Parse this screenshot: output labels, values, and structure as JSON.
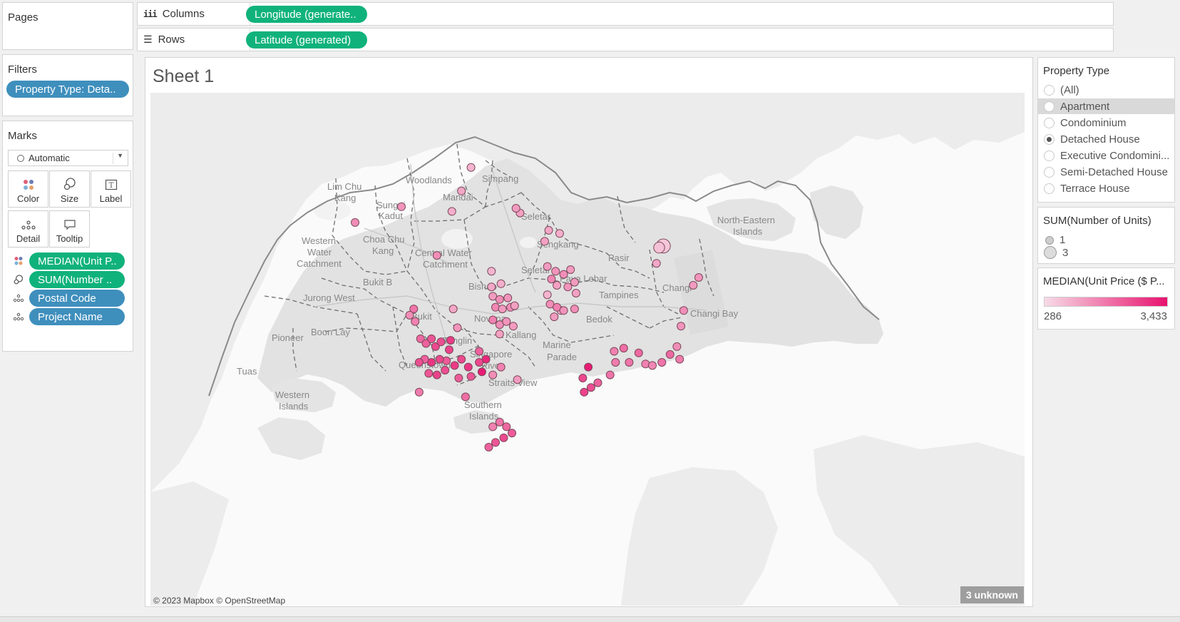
{
  "pages": {
    "title": "Pages"
  },
  "shelves": {
    "columns": {
      "label": "Columns",
      "pill": "Longitude (generate.."
    },
    "rows": {
      "label": "Rows",
      "pill": "Latitude (generated)"
    }
  },
  "filters": {
    "title": "Filters",
    "pill": "Property Type: Deta.."
  },
  "marks": {
    "title": "Marks",
    "mark_type": "Automatic",
    "buttons": {
      "color": "Color",
      "size": "Size",
      "label": "Label",
      "detail": "Detail",
      "tooltip": "Tooltip"
    },
    "fields": [
      "MEDIAN(Unit P..",
      "SUM(Number ..",
      "Postal Code",
      "Project Name"
    ],
    "field_icons": [
      "color-icon",
      "size-icon",
      "detail-icon",
      "detail-icon"
    ]
  },
  "sheet": {
    "title": "Sheet 1",
    "attribution": "© 2023 Mapbox © OpenStreetMap",
    "unknown_badge": "3 unknown"
  },
  "map_labels": [
    {
      "text": "Woodlands"
    },
    {
      "text": "Simpang"
    },
    {
      "text": "Lim Chu"
    },
    {
      "text": "Kang"
    },
    {
      "text": "Sungei"
    },
    {
      "text": "Kadut"
    },
    {
      "text": "Mandai"
    },
    {
      "text": "Seletar"
    },
    {
      "text": "North-Eastern"
    },
    {
      "text": "Islands"
    },
    {
      "text": "Western"
    },
    {
      "text": "Water"
    },
    {
      "text": "Catchment"
    },
    {
      "text": "Choa Chu"
    },
    {
      "text": "Kang"
    },
    {
      "text": "Central Water"
    },
    {
      "text": "Catchment"
    },
    {
      "text": "Sengkang"
    },
    {
      "text": "Pasir"
    },
    {
      "text": "Seletar"
    },
    {
      "text": "Paya Lebar"
    },
    {
      "text": "Bukit B"
    },
    {
      "text": "Bishan"
    },
    {
      "text": "Tampines"
    },
    {
      "text": "Changi"
    },
    {
      "text": "Jurong West"
    },
    {
      "text": "Bukit"
    },
    {
      "text": "Novena"
    },
    {
      "text": "Bedok"
    },
    {
      "text": "Changi Bay"
    },
    {
      "text": "Pioneer"
    },
    {
      "text": "Boon Lay"
    },
    {
      "text": "Tanglin"
    },
    {
      "text": "Kallang"
    },
    {
      "text": "Marine"
    },
    {
      "text": "Parade"
    },
    {
      "text": "Singapore"
    },
    {
      "text": "River"
    },
    {
      "text": "Queenstown"
    },
    {
      "text": "Tuas"
    },
    {
      "text": "Straits View"
    },
    {
      "text": "Western"
    },
    {
      "text": "Islands"
    },
    {
      "text": "Southern"
    },
    {
      "text": "Islands"
    }
  ],
  "property_type": {
    "title": "Property Type",
    "options": [
      "(All)",
      "Apartment",
      "Condominium",
      "Detached House",
      "Executive Condomini...",
      "Semi-Detached House",
      "Terrace House"
    ],
    "selected": "Detached House",
    "hovered": "Apartment"
  },
  "size_legend": {
    "title": "SUM(Number of Units)",
    "items": [
      "1",
      "3"
    ]
  },
  "color_legend": {
    "title": "MEDIAN(Unit Price ($ P...",
    "min": "286",
    "max": "3,433",
    "color_low": "#f7dbe6",
    "color_high": "#e8136f"
  },
  "chart_data": {
    "type": "scatter",
    "title": "Sheet 1",
    "xlabel": "Longitude (generated)",
    "ylabel": "Latitude (generated)",
    "size_field": "SUM(Number of Units)",
    "color_field": "MEDIAN(Unit Price ($ P...",
    "size_range": [
      1,
      3
    ],
    "color_range": [
      286,
      3433
    ],
    "unknown_count": 3,
    "points": [
      {
        "lon": 103.822,
        "lat": 1.427,
        "v": 900,
        "s": 1
      },
      {
        "lon": 103.815,
        "lat": 1.412,
        "v": 1100,
        "s": 1
      },
      {
        "lon": 103.808,
        "lat": 1.399,
        "v": 1000,
        "s": 1
      },
      {
        "lon": 103.771,
        "lat": 1.402,
        "v": 1400,
        "s": 1
      },
      {
        "lon": 103.737,
        "lat": 1.392,
        "v": 1500,
        "s": 1
      },
      {
        "lon": 103.858,
        "lat": 1.398,
        "v": 1200,
        "s": 1
      },
      {
        "lon": 103.855,
        "lat": 1.401,
        "v": 1300,
        "s": 1
      },
      {
        "lon": 103.797,
        "lat": 1.371,
        "v": 1500,
        "s": 1
      },
      {
        "lon": 103.837,
        "lat": 1.361,
        "v": 900,
        "s": 1
      },
      {
        "lon": 103.844,
        "lat": 1.353,
        "v": 1000,
        "s": 1
      },
      {
        "lon": 103.837,
        "lat": 1.351,
        "v": 1100,
        "s": 1
      },
      {
        "lon": 103.838,
        "lat": 1.345,
        "v": 1300,
        "s": 1
      },
      {
        "lon": 103.843,
        "lat": 1.343,
        "v": 1500,
        "s": 1
      },
      {
        "lon": 103.849,
        "lat": 1.344,
        "v": 1400,
        "s": 1
      },
      {
        "lon": 103.84,
        "lat": 1.338,
        "v": 1600,
        "s": 1
      },
      {
        "lon": 103.845,
        "lat": 1.337,
        "v": 1300,
        "s": 1
      },
      {
        "lon": 103.851,
        "lat": 1.338,
        "v": 1500,
        "s": 1
      },
      {
        "lon": 103.854,
        "lat": 1.339,
        "v": 1200,
        "s": 1
      },
      {
        "lon": 103.838,
        "lat": 1.33,
        "v": 1700,
        "s": 1
      },
      {
        "lon": 103.843,
        "lat": 1.327,
        "v": 1500,
        "s": 1
      },
      {
        "lon": 103.848,
        "lat": 1.329,
        "v": 1400,
        "s": 1
      },
      {
        "lon": 103.853,
        "lat": 1.326,
        "v": 1300,
        "s": 1
      },
      {
        "lon": 103.843,
        "lat": 1.321,
        "v": 1200,
        "s": 1
      },
      {
        "lon": 103.809,
        "lat": 1.337,
        "v": 1100,
        "s": 1
      },
      {
        "lon": 103.812,
        "lat": 1.325,
        "v": 1400,
        "s": 1
      },
      {
        "lon": 103.878,
        "lat": 1.346,
        "v": 900,
        "s": 1
      },
      {
        "lon": 103.888,
        "lat": 1.336,
        "v": 1000,
        "s": 1
      },
      {
        "lon": 103.78,
        "lat": 1.337,
        "v": 1900,
        "s": 1
      },
      {
        "lon": 103.777,
        "lat": 1.333,
        "v": 1500,
        "s": 1
      },
      {
        "lon": 103.781,
        "lat": 1.329,
        "v": 1700,
        "s": 1
      },
      {
        "lon": 103.785,
        "lat": 1.318,
        "v": 2100,
        "s": 1
      },
      {
        "lon": 103.789,
        "lat": 1.315,
        "v": 2200,
        "s": 1
      },
      {
        "lon": 103.793,
        "lat": 1.318,
        "v": 2400,
        "s": 1
      },
      {
        "lon": 103.796,
        "lat": 1.313,
        "v": 2600,
        "s": 1
      },
      {
        "lon": 103.8,
        "lat": 1.316,
        "v": 2500,
        "s": 1
      },
      {
        "lon": 103.806,
        "lat": 1.311,
        "v": 2700,
        "s": 1
      },
      {
        "lon": 103.807,
        "lat": 1.317,
        "v": 2800,
        "s": 1
      },
      {
        "lon": 103.804,
        "lat": 1.304,
        "v": 2300,
        "s": 1
      },
      {
        "lon": 103.799,
        "lat": 1.305,
        "v": 2600,
        "s": 1
      },
      {
        "lon": 103.793,
        "lat": 1.303,
        "v": 2900,
        "s": 1
      },
      {
        "lon": 103.788,
        "lat": 1.305,
        "v": 2200,
        "s": 1
      },
      {
        "lon": 103.784,
        "lat": 1.303,
        "v": 2500,
        "s": 1
      },
      {
        "lon": 103.791,
        "lat": 1.296,
        "v": 2400,
        "s": 1
      },
      {
        "lon": 103.797,
        "lat": 1.295,
        "v": 2700,
        "s": 1
      },
      {
        "lon": 103.803,
        "lat": 1.298,
        "v": 2500,
        "s": 1
      },
      {
        "lon": 103.81,
        "lat": 1.301,
        "v": 2800,
        "s": 1
      },
      {
        "lon": 103.815,
        "lat": 1.305,
        "v": 2600,
        "s": 1
      },
      {
        "lon": 103.82,
        "lat": 1.3,
        "v": 2900,
        "s": 1
      },
      {
        "lon": 103.813,
        "lat": 1.293,
        "v": 2300,
        "s": 1
      },
      {
        "lon": 103.822,
        "lat": 1.294,
        "v": 2400,
        "s": 1
      },
      {
        "lon": 103.828,
        "lat": 1.31,
        "v": 2200,
        "s": 1
      },
      {
        "lon": 103.833,
        "lat": 1.305,
        "v": 3100,
        "s": 1
      },
      {
        "lon": 103.828,
        "lat": 1.303,
        "v": 2600,
        "s": 1
      },
      {
        "lon": 103.83,
        "lat": 1.297,
        "v": 3300,
        "s": 1
      },
      {
        "lon": 103.784,
        "lat": 1.284,
        "v": 1800,
        "s": 1
      },
      {
        "lon": 103.818,
        "lat": 1.281,
        "v": 2000,
        "s": 1
      },
      {
        "lon": 103.844,
        "lat": 1.3,
        "v": 1700,
        "s": 1
      },
      {
        "lon": 103.838,
        "lat": 1.295,
        "v": 1500,
        "s": 1
      },
      {
        "lon": 103.856,
        "lat": 1.292,
        "v": 1300,
        "s": 1
      },
      {
        "lon": 103.908,
        "lat": 1.3,
        "v": 3300,
        "s": 1
      },
      {
        "lon": 103.904,
        "lat": 1.293,
        "v": 2600,
        "s": 1
      },
      {
        "lon": 103.905,
        "lat": 1.284,
        "v": 2700,
        "s": 1
      },
      {
        "lon": 103.91,
        "lat": 1.287,
        "v": 2500,
        "s": 1
      },
      {
        "lon": 103.915,
        "lat": 1.29,
        "v": 2200,
        "s": 1
      },
      {
        "lon": 103.924,
        "lat": 1.295,
        "v": 1900,
        "s": 1
      },
      {
        "lon": 103.928,
        "lat": 1.303,
        "v": 1800,
        "s": 1
      },
      {
        "lon": 103.927,
        "lat": 1.31,
        "v": 1700,
        "s": 1
      },
      {
        "lon": 103.934,
        "lat": 1.312,
        "v": 2000,
        "s": 1
      },
      {
        "lon": 103.938,
        "lat": 1.303,
        "v": 1900,
        "s": 1
      },
      {
        "lon": 103.945,
        "lat": 1.309,
        "v": 2100,
        "s": 1
      },
      {
        "lon": 103.95,
        "lat": 1.302,
        "v": 1700,
        "s": 1
      },
      {
        "lon": 103.955,
        "lat": 1.301,
        "v": 1600,
        "s": 1
      },
      {
        "lon": 103.962,
        "lat": 1.303,
        "v": 1900,
        "s": 1
      },
      {
        "lon": 103.968,
        "lat": 1.308,
        "v": 2100,
        "s": 1
      },
      {
        "lon": 103.973,
        "lat": 1.313,
        "v": 1500,
        "s": 1
      },
      {
        "lon": 103.975,
        "lat": 1.305,
        "v": 1800,
        "s": 1
      },
      {
        "lon": 103.976,
        "lat": 1.326,
        "v": 1400,
        "s": 1
      },
      {
        "lon": 103.978,
        "lat": 1.336,
        "v": 1500,
        "s": 1
      },
      {
        "lon": 103.985,
        "lat": 1.352,
        "v": 1300,
        "s": 1
      },
      {
        "lon": 103.989,
        "lat": 1.357,
        "v": 1400,
        "s": 1
      },
      {
        "lon": 103.958,
        "lat": 1.366,
        "v": 1100,
        "s": 1
      },
      {
        "lon": 103.963,
        "lat": 1.377,
        "v": 600,
        "s": 3
      },
      {
        "lon": 103.96,
        "lat": 1.376,
        "v": 700,
        "s": 2
      },
      {
        "lon": 103.876,
        "lat": 1.38,
        "v": 1200,
        "s": 1
      },
      {
        "lon": 103.879,
        "lat": 1.387,
        "v": 1100,
        "s": 1
      },
      {
        "lon": 103.887,
        "lat": 1.385,
        "v": 1000,
        "s": 1
      },
      {
        "lon": 103.878,
        "lat": 1.364,
        "v": 1300,
        "s": 1
      },
      {
        "lon": 103.884,
        "lat": 1.361,
        "v": 1400,
        "s": 1
      },
      {
        "lon": 103.89,
        "lat": 1.359,
        "v": 1500,
        "s": 1
      },
      {
        "lon": 103.895,
        "lat": 1.362,
        "v": 1300,
        "s": 1
      },
      {
        "lon": 103.881,
        "lat": 1.356,
        "v": 1600,
        "s": 1
      },
      {
        "lon": 103.885,
        "lat": 1.352,
        "v": 1200,
        "s": 1
      },
      {
        "lon": 103.893,
        "lat": 1.351,
        "v": 1400,
        "s": 1
      },
      {
        "lon": 103.898,
        "lat": 1.354,
        "v": 1300,
        "s": 1
      },
      {
        "lon": 103.899,
        "lat": 1.347,
        "v": 1200,
        "s": 1
      },
      {
        "lon": 103.88,
        "lat": 1.34,
        "v": 1500,
        "s": 1
      },
      {
        "lon": 103.885,
        "lat": 1.338,
        "v": 1700,
        "s": 1
      },
      {
        "lon": 103.89,
        "lat": 1.336,
        "v": 1400,
        "s": 1
      },
      {
        "lon": 103.898,
        "lat": 1.337,
        "v": 1500,
        "s": 1
      },
      {
        "lon": 103.883,
        "lat": 1.332,
        "v": 1300,
        "s": 1
      },
      {
        "lon": 103.838,
        "lat": 1.262,
        "v": 1700,
        "s": 1
      },
      {
        "lon": 103.843,
        "lat": 1.265,
        "v": 1900,
        "s": 1
      },
      {
        "lon": 103.848,
        "lat": 1.262,
        "v": 2100,
        "s": 1
      },
      {
        "lon": 103.852,
        "lat": 1.258,
        "v": 2300,
        "s": 1
      },
      {
        "lon": 103.846,
        "lat": 1.255,
        "v": 2600,
        "s": 1
      },
      {
        "lon": 103.84,
        "lat": 1.252,
        "v": 2400,
        "s": 1
      },
      {
        "lon": 103.835,
        "lat": 1.249,
        "v": 2200,
        "s": 1
      }
    ]
  }
}
